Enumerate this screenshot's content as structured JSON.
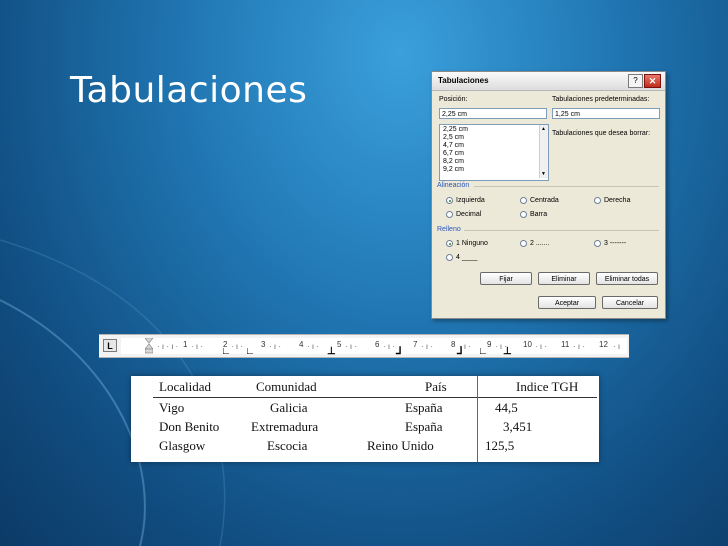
{
  "slide": {
    "title": "Tabulaciones"
  },
  "dialog": {
    "title": "Tabulaciones",
    "help_label": "?",
    "close_label": "✕",
    "position_label": "Posición:",
    "position_value": "2,25 cm",
    "default_tabs_label": "Tabulaciones predeterminadas:",
    "default_tabs_value": "1,25 cm",
    "clear_label": "Tabulaciones que desea borrar:",
    "tab_list": [
      "2,25 cm",
      "2,5 cm",
      "4,7 cm",
      "6,7 cm",
      "8,2 cm",
      "9,2 cm"
    ],
    "alignment": {
      "label": "Alineación",
      "options": [
        "Izquierda",
        "Centrada",
        "Derecha",
        "Decimal",
        "Barra"
      ],
      "selected": "Izquierda"
    },
    "leader": {
      "label": "Relleno",
      "options": [
        "1 Ninguno",
        "2 .......",
        "3 -------",
        "4 ____"
      ],
      "selected": "1 Ninguno"
    },
    "buttons": {
      "set": "Fijar",
      "clear": "Eliminar",
      "clear_all": "Eliminar todas",
      "ok": "Aceptar",
      "cancel": "Cancelar"
    }
  },
  "ruler": {
    "tab_selector": "L",
    "numbers": [
      "1",
      "2",
      "3",
      "4",
      "5",
      "6",
      "7",
      "8",
      "9",
      "10",
      "11",
      "12"
    ]
  },
  "table": {
    "headers": [
      "Localidad",
      "Comunidad",
      "País",
      "Indice TGH"
    ],
    "rows": [
      [
        "Vigo",
        "Galicia",
        "España",
        "44,5"
      ],
      [
        "Don Benito",
        "Extremadura",
        "España",
        "3,451"
      ],
      [
        "Glasgow",
        "Escocia",
        "Reino Unido",
        "125,5"
      ]
    ]
  }
}
